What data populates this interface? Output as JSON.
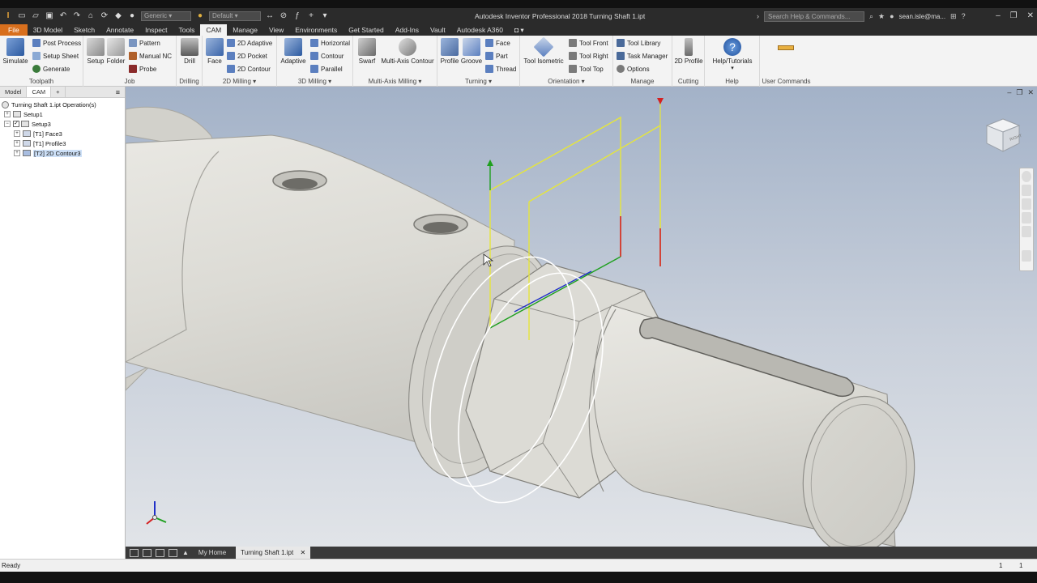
{
  "titlebar": {
    "workspace_select": "Generic",
    "appearance_select": "Default",
    "title": "Autodesk Inventor Professional 2018   Turning Shaft 1.ipt",
    "search_placeholder": "Search Help & Commands...",
    "user": "sean.isle@ma..."
  },
  "ribbon_tabs": [
    "File",
    "3D Model",
    "Sketch",
    "Annotate",
    "Inspect",
    "Tools",
    "CAM",
    "Manage",
    "View",
    "Environments",
    "Get Started",
    "Add-Ins",
    "Vault",
    "Autodesk A360"
  ],
  "active_tab": "CAM",
  "ribbon": {
    "toolpath": {
      "label": "Toolpath",
      "simulate": "Simulate",
      "post_process": "Post Process",
      "setup_sheet": "Setup Sheet",
      "generate": "Generate"
    },
    "job": {
      "label": "Job",
      "setup": "Setup",
      "folder": "Folder",
      "pattern": "Pattern",
      "manual_nc": "Manual NC",
      "probe": "Probe"
    },
    "drilling": {
      "label": "Drilling",
      "drill": "Drill"
    },
    "milling2d": {
      "label": "2D Milling",
      "face": "Face",
      "adaptive": "2D Adaptive",
      "pocket": "2D Pocket",
      "contour": "2D Contour"
    },
    "milling3d": {
      "label": "3D Milling",
      "adaptive": "Adaptive",
      "horizontal": "Horizontal",
      "contour": "Contour",
      "parallel": "Parallel"
    },
    "multiaxis": {
      "label": "Multi-Axis Milling",
      "swarf": "Swarf",
      "multi_axis_contour": "Multi-Axis Contour"
    },
    "turning": {
      "label": "Turning",
      "profile": "Profile",
      "groove": "Groove",
      "face": "Face",
      "part": "Part",
      "thread": "Thread"
    },
    "orientation": {
      "label": "Orientation",
      "tool_isometric": "Tool Isometric",
      "tool_front": "Tool Front",
      "tool_right": "Tool Right",
      "tool_top": "Tool Top"
    },
    "manage": {
      "label": "Manage",
      "tool_library": "Tool Library",
      "task_manager": "Task Manager",
      "options": "Options"
    },
    "cutting": {
      "label": "Cutting",
      "profile_2d": "2D Profile"
    },
    "help": {
      "label": "Help",
      "help_tutorials": "Help/Tutorials"
    },
    "user_commands": {
      "label": "User Commands"
    }
  },
  "browser": {
    "tabs": [
      "Model",
      "CAM",
      "+"
    ],
    "root": "Turning Shaft 1.ipt Operation(s)",
    "items": [
      {
        "label": "Setup1",
        "level": 1
      },
      {
        "label": "Setup3",
        "level": 1
      },
      {
        "label": "[T1] Face3",
        "level": 2
      },
      {
        "label": "[T1] Profile3",
        "level": 2
      },
      {
        "label": "[T2] 2D Contour3",
        "level": 2
      }
    ]
  },
  "viewcube": {
    "face_label": "RIGHT"
  },
  "doc_tabs": {
    "home": "My Home",
    "active": "Turning Shaft 1.ipt"
  },
  "status": {
    "text": "Ready",
    "count1": "1",
    "count2": "1"
  },
  "colors": {
    "file_tab": "#d86f1d",
    "viewport_top": "#a3b2c8",
    "viewport_bottom": "#e1e4e8",
    "axis_x": "#d42020",
    "axis_y": "#1ea01e",
    "axis_z": "#2030c8",
    "stock_outline": "#e0e020"
  }
}
